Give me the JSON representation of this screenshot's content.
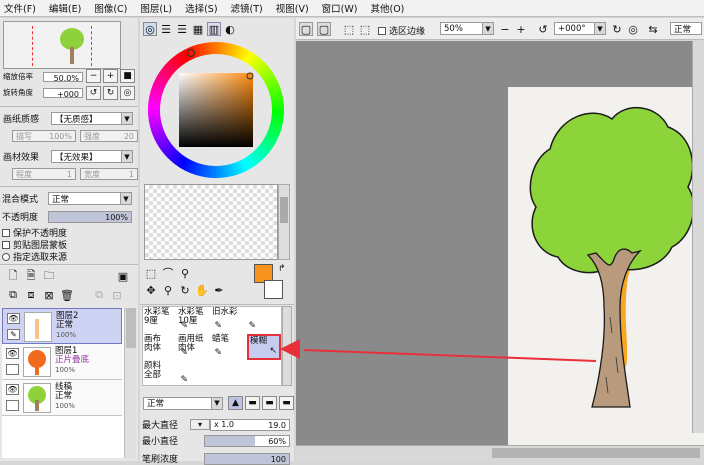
{
  "menu": [
    "文件(F)",
    "编辑(E)",
    "图像(C)",
    "图层(L)",
    "选择(S)",
    "滤镜(T)",
    "视图(V)",
    "窗口(W)",
    "其他(O)"
  ],
  "nav": {
    "zoom_label": "缩放倍率",
    "zoom_value": "50.0%",
    "rotate_label": "旋转角度",
    "rotate_value": "+000"
  },
  "paper": {
    "texture_label": "画纸质感",
    "texture_value": "【无质感】",
    "blend_label": "描写",
    "blend_value": "100%",
    "strength_label": "强度",
    "strength_value": "20",
    "effect_label": "画材效果",
    "effect_value": "【无效果】",
    "degree_label": "程度",
    "degree_value": "1",
    "width_label": "宽度",
    "width_value": "1"
  },
  "layer_props": {
    "blend_mode_label": "混合模式",
    "blend_mode_value": "正常",
    "opacity_label": "不透明度",
    "opacity_value": "100%",
    "opacity_fraction": 1.0,
    "check1": "保护不透明度",
    "check2": "剪贴图层蒙板",
    "check3": "指定选取来源"
  },
  "layers": [
    {
      "name": "图层2",
      "mode": "正常",
      "opacity": "100%"
    },
    {
      "name": "图层1",
      "mode": "正片叠底",
      "opacity": "100%"
    },
    {
      "name": "线稿",
      "mode": "正常",
      "opacity": "100%"
    }
  ],
  "brushes": [
    {
      "label1": "水彩笔",
      "label2": "9厘"
    },
    {
      "label1": "水彩笔",
      "label2": "10厘"
    },
    {
      "label1": "旧水彩",
      "label2": ""
    },
    {
      "label1": "画布",
      "label2": "肉体"
    },
    {
      "label1": "画用纸",
      "label2": "肉体"
    },
    {
      "label1": "蜡笔",
      "label2": ""
    },
    {
      "label1": "模糊",
      "label2": ""
    },
    {
      "label1": "颜料",
      "label2": "全部"
    }
  ],
  "brush_settings": {
    "mode_value": "正常",
    "max_label": "最大直径",
    "max_scale": "x 1.0",
    "max_value": "19.0",
    "min_label": "最小直径",
    "min_value": "60%",
    "min_fraction": 0.6,
    "density_label": "笔刷浓度",
    "density_value": "100"
  },
  "canvas_toolbar": {
    "sel_edge": "选区边缘",
    "zoom": "50%",
    "angle": "+000°",
    "mode": "正常"
  },
  "colors": {
    "primary": "#f7941d",
    "accent": "#e8303a",
    "selected_layer": "#cfd3f3"
  }
}
